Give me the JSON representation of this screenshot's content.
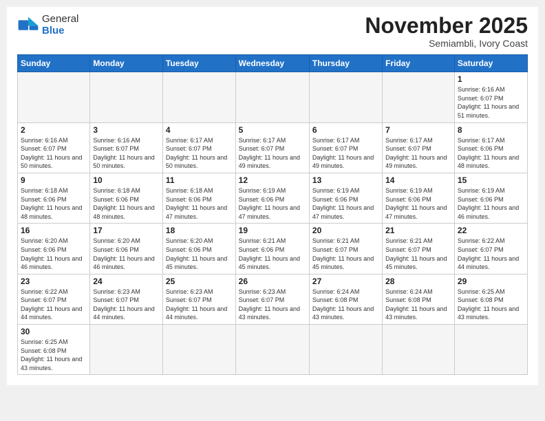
{
  "logo": {
    "text_general": "General",
    "text_blue": "Blue"
  },
  "header": {
    "month": "November 2025",
    "location": "Semiambli, Ivory Coast"
  },
  "days_of_week": [
    "Sunday",
    "Monday",
    "Tuesday",
    "Wednesday",
    "Thursday",
    "Friday",
    "Saturday"
  ],
  "weeks": [
    [
      {
        "day": "",
        "info": ""
      },
      {
        "day": "",
        "info": ""
      },
      {
        "day": "",
        "info": ""
      },
      {
        "day": "",
        "info": ""
      },
      {
        "day": "",
        "info": ""
      },
      {
        "day": "",
        "info": ""
      },
      {
        "day": "1",
        "info": "Sunrise: 6:16 AM\nSunset: 6:07 PM\nDaylight: 11 hours and 51 minutes."
      }
    ],
    [
      {
        "day": "2",
        "info": "Sunrise: 6:16 AM\nSunset: 6:07 PM\nDaylight: 11 hours and 50 minutes."
      },
      {
        "day": "3",
        "info": "Sunrise: 6:16 AM\nSunset: 6:07 PM\nDaylight: 11 hours and 50 minutes."
      },
      {
        "day": "4",
        "info": "Sunrise: 6:17 AM\nSunset: 6:07 PM\nDaylight: 11 hours and 50 minutes."
      },
      {
        "day": "5",
        "info": "Sunrise: 6:17 AM\nSunset: 6:07 PM\nDaylight: 11 hours and 49 minutes."
      },
      {
        "day": "6",
        "info": "Sunrise: 6:17 AM\nSunset: 6:07 PM\nDaylight: 11 hours and 49 minutes."
      },
      {
        "day": "7",
        "info": "Sunrise: 6:17 AM\nSunset: 6:07 PM\nDaylight: 11 hours and 49 minutes."
      },
      {
        "day": "8",
        "info": "Sunrise: 6:17 AM\nSunset: 6:06 PM\nDaylight: 11 hours and 48 minutes."
      }
    ],
    [
      {
        "day": "9",
        "info": "Sunrise: 6:18 AM\nSunset: 6:06 PM\nDaylight: 11 hours and 48 minutes."
      },
      {
        "day": "10",
        "info": "Sunrise: 6:18 AM\nSunset: 6:06 PM\nDaylight: 11 hours and 48 minutes."
      },
      {
        "day": "11",
        "info": "Sunrise: 6:18 AM\nSunset: 6:06 PM\nDaylight: 11 hours and 47 minutes."
      },
      {
        "day": "12",
        "info": "Sunrise: 6:19 AM\nSunset: 6:06 PM\nDaylight: 11 hours and 47 minutes."
      },
      {
        "day": "13",
        "info": "Sunrise: 6:19 AM\nSunset: 6:06 PM\nDaylight: 11 hours and 47 minutes."
      },
      {
        "day": "14",
        "info": "Sunrise: 6:19 AM\nSunset: 6:06 PM\nDaylight: 11 hours and 47 minutes."
      },
      {
        "day": "15",
        "info": "Sunrise: 6:19 AM\nSunset: 6:06 PM\nDaylight: 11 hours and 46 minutes."
      }
    ],
    [
      {
        "day": "16",
        "info": "Sunrise: 6:20 AM\nSunset: 6:06 PM\nDaylight: 11 hours and 46 minutes."
      },
      {
        "day": "17",
        "info": "Sunrise: 6:20 AM\nSunset: 6:06 PM\nDaylight: 11 hours and 46 minutes."
      },
      {
        "day": "18",
        "info": "Sunrise: 6:20 AM\nSunset: 6:06 PM\nDaylight: 11 hours and 45 minutes."
      },
      {
        "day": "19",
        "info": "Sunrise: 6:21 AM\nSunset: 6:06 PM\nDaylight: 11 hours and 45 minutes."
      },
      {
        "day": "20",
        "info": "Sunrise: 6:21 AM\nSunset: 6:07 PM\nDaylight: 11 hours and 45 minutes."
      },
      {
        "day": "21",
        "info": "Sunrise: 6:21 AM\nSunset: 6:07 PM\nDaylight: 11 hours and 45 minutes."
      },
      {
        "day": "22",
        "info": "Sunrise: 6:22 AM\nSunset: 6:07 PM\nDaylight: 11 hours and 44 minutes."
      }
    ],
    [
      {
        "day": "23",
        "info": "Sunrise: 6:22 AM\nSunset: 6:07 PM\nDaylight: 11 hours and 44 minutes."
      },
      {
        "day": "24",
        "info": "Sunrise: 6:23 AM\nSunset: 6:07 PM\nDaylight: 11 hours and 44 minutes."
      },
      {
        "day": "25",
        "info": "Sunrise: 6:23 AM\nSunset: 6:07 PM\nDaylight: 11 hours and 44 minutes."
      },
      {
        "day": "26",
        "info": "Sunrise: 6:23 AM\nSunset: 6:07 PM\nDaylight: 11 hours and 43 minutes."
      },
      {
        "day": "27",
        "info": "Sunrise: 6:24 AM\nSunset: 6:08 PM\nDaylight: 11 hours and 43 minutes."
      },
      {
        "day": "28",
        "info": "Sunrise: 6:24 AM\nSunset: 6:08 PM\nDaylight: 11 hours and 43 minutes."
      },
      {
        "day": "29",
        "info": "Sunrise: 6:25 AM\nSunset: 6:08 PM\nDaylight: 11 hours and 43 minutes."
      }
    ],
    [
      {
        "day": "30",
        "info": "Sunrise: 6:25 AM\nSunset: 6:08 PM\nDaylight: 11 hours and 43 minutes."
      },
      {
        "day": "",
        "info": ""
      },
      {
        "day": "",
        "info": ""
      },
      {
        "day": "",
        "info": ""
      },
      {
        "day": "",
        "info": ""
      },
      {
        "day": "",
        "info": ""
      },
      {
        "day": "",
        "info": ""
      }
    ]
  ]
}
